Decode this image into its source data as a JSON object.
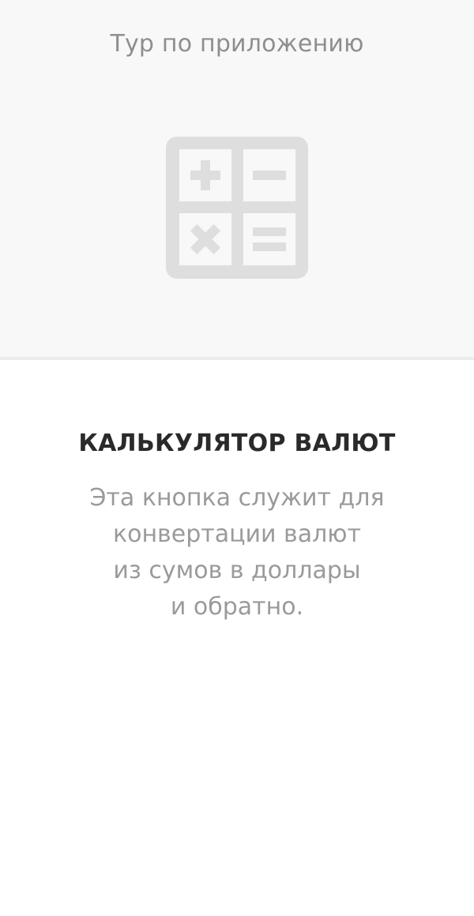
{
  "tour": {
    "title": "Тур по приложению"
  },
  "hero": {
    "icon": "calculator-icon",
    "icon_color": "#dedede",
    "background": "#f8f8f8"
  },
  "feature": {
    "title": "КАЛЬКУЛЯТОР ВАЛЮТ",
    "description_lines": [
      "Эта кнопка служит для",
      "конвертации валют",
      "из сумов в доллары",
      "и обратно."
    ]
  },
  "colors": {
    "title_text": "#2a2a2a",
    "muted_text": "#9a9a9a",
    "header_text": "#8e8e8e"
  }
}
